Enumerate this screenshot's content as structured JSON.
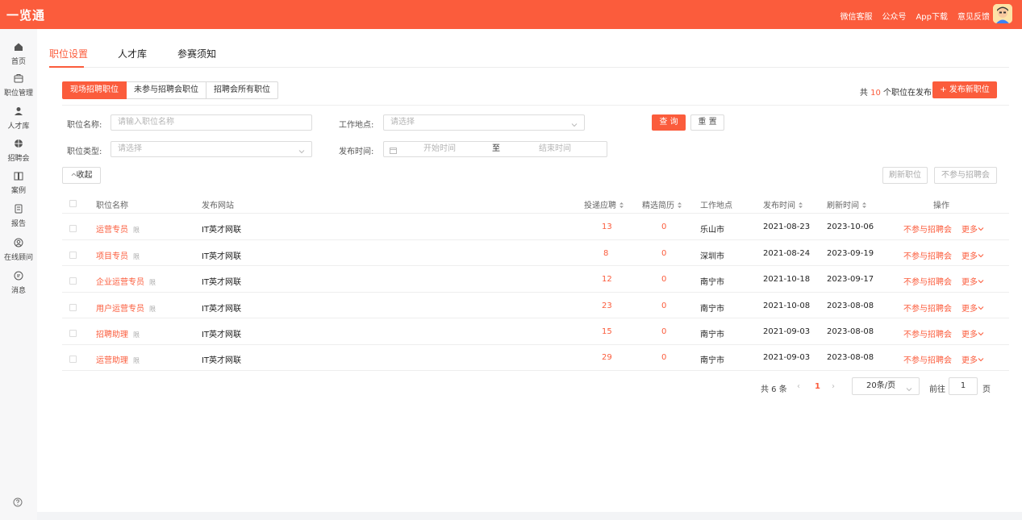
{
  "header": {
    "brand": "一览通",
    "links": [
      "微信客服",
      "公众号",
      "App下载",
      "意见反馈"
    ]
  },
  "sidebar": {
    "items": [
      {
        "label": "首页",
        "icon": "home-icon"
      },
      {
        "label": "职位管理",
        "icon": "briefcase-icon"
      },
      {
        "label": "人才库",
        "icon": "person-icon"
      },
      {
        "label": "招聘会",
        "icon": "fair-icon"
      },
      {
        "label": "案例",
        "icon": "book-icon"
      },
      {
        "label": "报告",
        "icon": "report-icon"
      },
      {
        "label": "在线顾问",
        "icon": "advisor-icon"
      },
      {
        "label": "消息",
        "icon": "message-icon"
      }
    ]
  },
  "tabs": [
    "职位设置",
    "人才库",
    "参赛须知"
  ],
  "segments": [
    "现场招聘职位",
    "未参与招聘会职位",
    "招聘会所有职位"
  ],
  "summary": {
    "prefix": "共",
    "count": "10",
    "suffix": "个职位在发布中"
  },
  "publish_button": "+ 发布新职位",
  "filters": {
    "job_name_label": "职位名称:",
    "job_name_placeholder": "请输入职位名称",
    "location_label": "工作地点:",
    "location_placeholder": "请选择",
    "type_label": "职位类型:",
    "type_placeholder": "请选择",
    "time_label": "发布时间:",
    "start_placeholder": "开始时间",
    "to": "至",
    "end_placeholder": "结束时间",
    "query": "查 询",
    "reset": "重 置",
    "collapse": "收起"
  },
  "actions": {
    "refresh": "刷新职位",
    "skip": "不参与招聘会"
  },
  "table": {
    "headers": [
      "职位名称",
      "发布网站",
      "投递应聘",
      "精选简历",
      "工作地点",
      "发布时间",
      "刷新时间",
      "操作"
    ],
    "tag": "限",
    "op_primary": "不参与招聘会",
    "op_more": "更多",
    "rows": [
      {
        "name": "运营专员",
        "site": "IT英才网联",
        "applied": "13",
        "selected": "0",
        "city": "乐山市",
        "published": "2021-08-23",
        "refreshed": "2023-10-06"
      },
      {
        "name": "项目专员",
        "site": "IT英才网联",
        "applied": "8",
        "selected": "0",
        "city": "深圳市",
        "published": "2021-08-24",
        "refreshed": "2023-09-19"
      },
      {
        "name": "企业运营专员",
        "site": "IT英才网联",
        "applied": "12",
        "selected": "0",
        "city": "南宁市",
        "published": "2021-10-18",
        "refreshed": "2023-09-17"
      },
      {
        "name": "用户运营专员",
        "site": "IT英才网联",
        "applied": "23",
        "selected": "0",
        "city": "南宁市",
        "published": "2021-10-08",
        "refreshed": "2023-08-08"
      },
      {
        "name": "招聘助理",
        "site": "IT英才网联",
        "applied": "15",
        "selected": "0",
        "city": "南宁市",
        "published": "2021-09-03",
        "refreshed": "2023-08-08"
      },
      {
        "name": "运营助理",
        "site": "IT英才网联",
        "applied": "29",
        "selected": "0",
        "city": "南宁市",
        "published": "2021-09-03",
        "refreshed": "2023-08-08"
      }
    ]
  },
  "pagination": {
    "total": "共 6 条",
    "current": "1",
    "page_size": "20条/页",
    "goto_label": "前往",
    "goto_value": "1",
    "page_suffix": "页"
  },
  "colors": {
    "accent": "#fb5c3c"
  }
}
